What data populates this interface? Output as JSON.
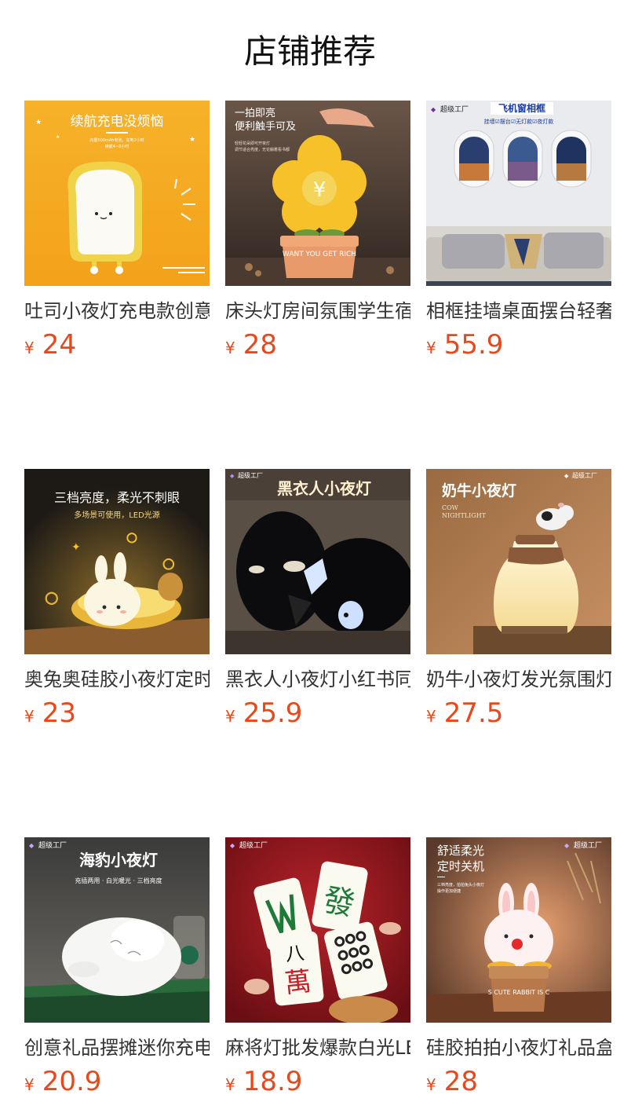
{
  "section_title": "店铺推荐",
  "products": [
    {
      "name": "吐司小夜灯充电款创意",
      "currency": "¥",
      "price": "24",
      "image_text": {
        "headline": "续航充电没烦恼",
        "sub1": "内置500mAh电池，充电2小时",
        "sub2": "续航4~8小时"
      }
    },
    {
      "name": "床头灯房间氛围学生宿舍",
      "currency": "¥",
      "price": "28",
      "image_text": {
        "line1": "一拍即亮",
        "line2": "便利触手可及",
        "sub1": "轻轻花朵即可开夜灯",
        "sub2": "调节适合亮度，无论躺着看书都",
        "symbol": "¥",
        "pot": "WANT YOU GET RICH"
      }
    },
    {
      "name": "相框挂墙桌面摆台轻奢",
      "currency": "¥",
      "price": "55.9",
      "image_text": {
        "brand": "超级工厂",
        "title": "飞机窗相框",
        "sub": "挂墙☑摆台☑无灯款☑夜灯款"
      }
    },
    {
      "name": "奥兔奥硅胶小夜灯定时",
      "currency": "¥",
      "price": "23",
      "image_text": {
        "headline": "三档亮度，柔光不刺眼",
        "sub": "多场景可使用，LED光源"
      }
    },
    {
      "name": "黑衣人小夜灯小红书同款",
      "currency": "¥",
      "price": "25.9",
      "image_text": {
        "brand": "超级工厂",
        "headline": "黑衣人小夜灯"
      }
    },
    {
      "name": "奶牛小夜灯发光氛围灯",
      "currency": "¥",
      "price": "27.5",
      "image_text": {
        "brand": "超级工厂",
        "headline": "奶牛小夜灯",
        "en1": "COW",
        "en2": "NIGHTLIGHT"
      }
    },
    {
      "name": "创意礼品摆摊迷你充电",
      "currency": "¥",
      "price": "20.9",
      "image_text": {
        "brand": "超级工厂",
        "headline": "海豹小夜灯",
        "sub": "充插两用 · 白光暖光 · 三档亮度"
      }
    },
    {
      "name": "麻将灯批发爆款白光LED",
      "currency": "¥",
      "price": "18.9",
      "image_text": {
        "brand": "超级工厂",
        "tile1": "發",
        "tile2": "八",
        "tile3": "萬"
      }
    },
    {
      "name": "硅胶拍拍小夜灯礼品盒",
      "currency": "¥",
      "price": "28",
      "image_text": {
        "brand": "超级工厂",
        "line1": "舒适柔光",
        "line2": "定时关机",
        "sub1": "三档亮度，拍拍兔头小夜灯",
        "sub2": "操作更加便捷",
        "pot": "S CUTE RABBIT IS C"
      }
    }
  ],
  "colors": {
    "price": "#e8481a",
    "title": "#111111",
    "name": "#333333"
  }
}
